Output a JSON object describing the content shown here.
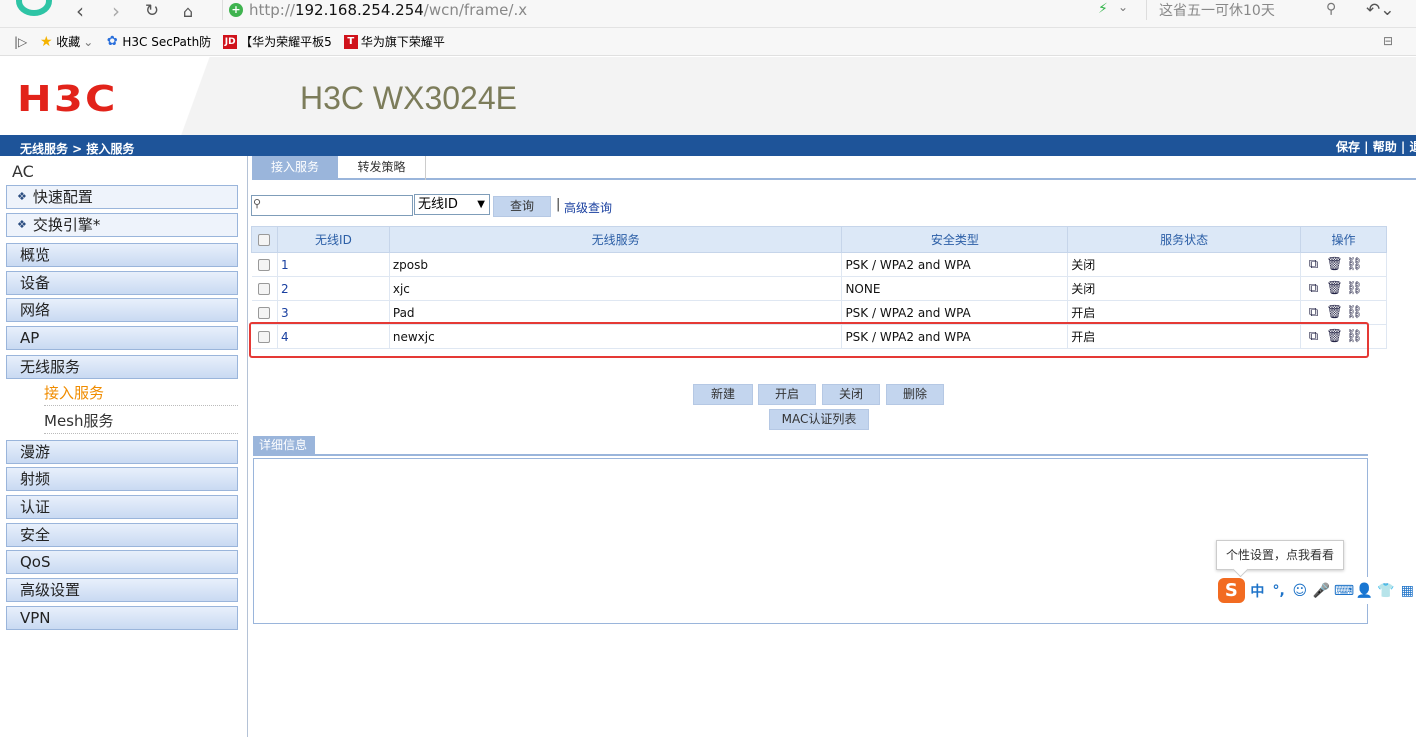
{
  "browser": {
    "url_scheme": "http://",
    "url_host": "192.168.254.254",
    "url_path": "/wcn/frame/.x",
    "search_placeholder": "这省五一可休10天"
  },
  "favorites": [
    {
      "label": "收藏",
      "icon": "star-icon",
      "caret": "⌄",
      "color": "#f5b300"
    },
    {
      "label": "H3C SecPath防",
      "icon": "paw-icon",
      "color": "#2a6fdb"
    },
    {
      "label": "【华为荣耀平板5",
      "icon": "jd-icon",
      "icon_text": "JD",
      "color": "#d0121b"
    },
    {
      "label": "华为旗下荣耀平",
      "icon": "tmall-icon",
      "icon_text": "T",
      "color": "#d0121b"
    }
  ],
  "header": {
    "logo": "H3C",
    "product": "H3C WX3024E"
  },
  "topbar": {
    "breadcrumb": "无线服务 > 接入服务",
    "links": "保存 | 帮助 | 退"
  },
  "nav": {
    "root": "AC",
    "special": [
      "快速配置",
      "交换引擎*"
    ],
    "items_top": [
      "概览",
      "设备",
      "网络",
      "AP",
      "无线服务"
    ],
    "sub_items": [
      "接入服务",
      "Mesh服务"
    ],
    "items_bottom": [
      "漫游",
      "射频",
      "认证",
      "安全",
      "QoS",
      "高级设置",
      "VPN"
    ]
  },
  "tabs": [
    "接入服务",
    "转发策略"
  ],
  "query": {
    "input_value": "",
    "select_value": "无线ID",
    "button": "查询",
    "advanced": "高级查询"
  },
  "table": {
    "headers": [
      "无线ID",
      "无线服务",
      "安全类型",
      "服务状态",
      "操作"
    ],
    "rows": [
      {
        "id": "1",
        "name": "zposb",
        "security": "PSK / WPA2 and WPA",
        "status": "关闭"
      },
      {
        "id": "2",
        "name": "xjc",
        "security": "NONE",
        "status": "关闭"
      },
      {
        "id": "3",
        "name": "Pad",
        "security": "PSK / WPA2 and WPA",
        "status": "开启"
      },
      {
        "id": "4",
        "name": "newxjc",
        "security": "PSK / WPA2 and WPA",
        "status": "开启"
      }
    ]
  },
  "actions": {
    "new": "新建",
    "enable": "开启",
    "disable": "关闭",
    "delete": "删除",
    "mac_list": "MAC认证列表"
  },
  "detail": {
    "tab": "详细信息"
  },
  "ime": {
    "tip": "个性设置，点我看看",
    "logo": "S",
    "icons": [
      "中",
      "°,",
      "☺",
      "🎤",
      "⌨",
      "👤",
      "👕",
      "▦"
    ]
  },
  "colors": {
    "brand_red": "#e2231a",
    "nav_blue": "#1e5499",
    "accent_orange": "#f08c00",
    "highlight_red": "#e53935"
  }
}
